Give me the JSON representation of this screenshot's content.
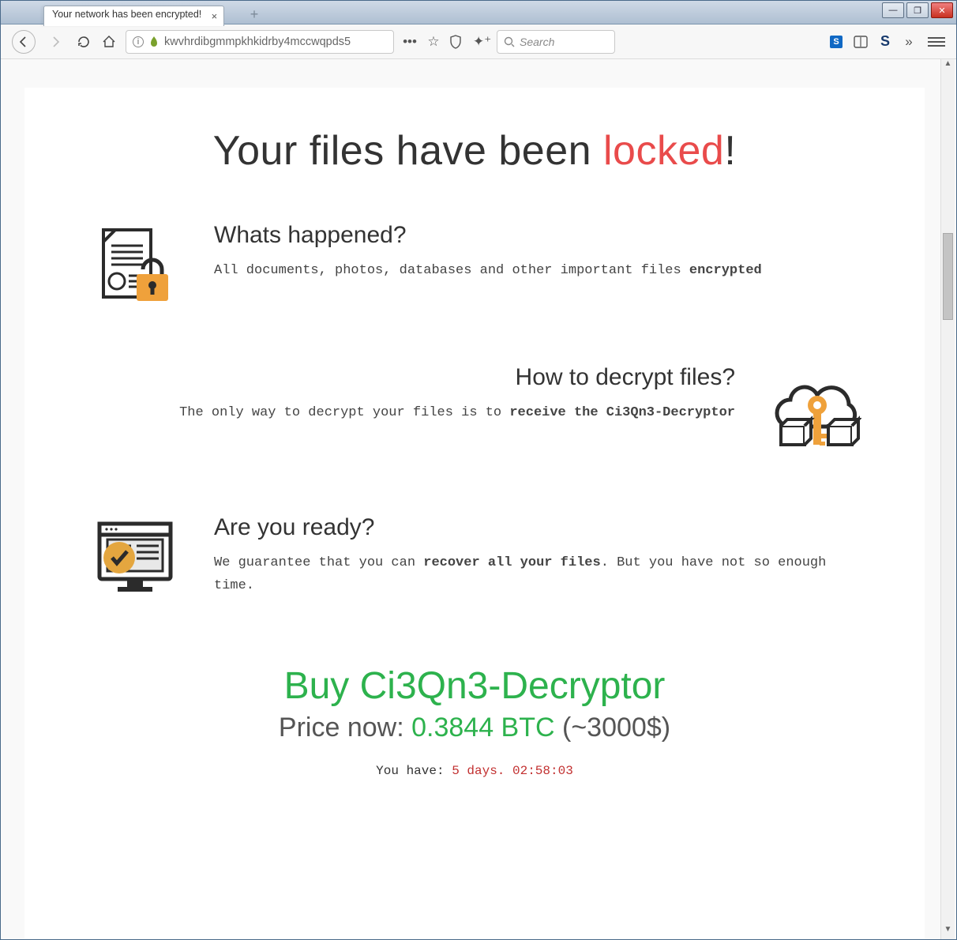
{
  "browser": {
    "tab_title": "Your network has been encrypted!",
    "address": "kwvhrdibgmmpkhkidrby4mccwqpds5",
    "search_placeholder": "Search"
  },
  "content": {
    "title_prefix": "Your files have been ",
    "title_highlight": "locked",
    "title_suffix": "!",
    "section1": {
      "heading": "Whats happened?",
      "body_prefix": "All documents, photos, databases and other important files ",
      "body_bold": "encrypted"
    },
    "section2": {
      "heading": "How to decrypt files?",
      "body_prefix": "The only way to decrypt your files is to ",
      "body_bold": "receive the Ci3Qn3-Decryptor"
    },
    "section3": {
      "heading": "Are you ready?",
      "body_prefix": "We guarantee that you can ",
      "body_bold": "recover all your files",
      "body_suffix": ". But you have not so enough time."
    },
    "buy": {
      "heading": "Buy Ci3Qn3-Decryptor",
      "price_label": "Price now: ",
      "price_btc": "0.3844 BTC",
      "price_usd": " (~3000$)",
      "timer_label": "You have: ",
      "timer_value": "5 days. 02:58:03"
    }
  }
}
